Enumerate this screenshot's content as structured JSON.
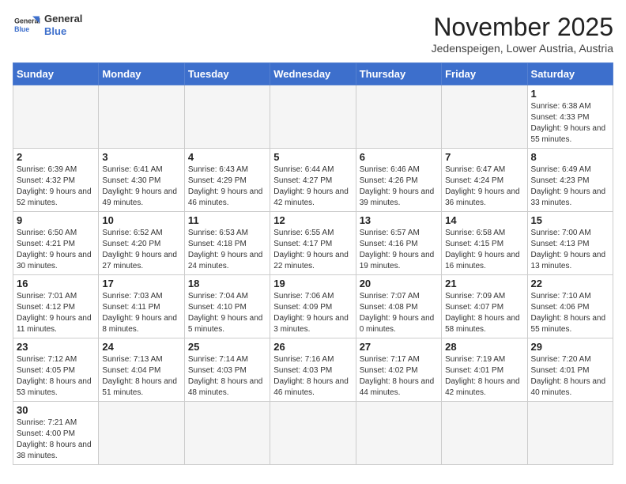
{
  "logo": {
    "line1": "General",
    "line2": "Blue"
  },
  "title": "November 2025",
  "subtitle": "Jedenspeigen, Lower Austria, Austria",
  "weekdays": [
    "Sunday",
    "Monday",
    "Tuesday",
    "Wednesday",
    "Thursday",
    "Friday",
    "Saturday"
  ],
  "weeks": [
    [
      {
        "day": "",
        "info": ""
      },
      {
        "day": "",
        "info": ""
      },
      {
        "day": "",
        "info": ""
      },
      {
        "day": "",
        "info": ""
      },
      {
        "day": "",
        "info": ""
      },
      {
        "day": "",
        "info": ""
      },
      {
        "day": "1",
        "info": "Sunrise: 6:38 AM\nSunset: 4:33 PM\nDaylight: 9 hours and 55 minutes."
      }
    ],
    [
      {
        "day": "2",
        "info": "Sunrise: 6:39 AM\nSunset: 4:32 PM\nDaylight: 9 hours and 52 minutes."
      },
      {
        "day": "3",
        "info": "Sunrise: 6:41 AM\nSunset: 4:30 PM\nDaylight: 9 hours and 49 minutes."
      },
      {
        "day": "4",
        "info": "Sunrise: 6:43 AM\nSunset: 4:29 PM\nDaylight: 9 hours and 46 minutes."
      },
      {
        "day": "5",
        "info": "Sunrise: 6:44 AM\nSunset: 4:27 PM\nDaylight: 9 hours and 42 minutes."
      },
      {
        "day": "6",
        "info": "Sunrise: 6:46 AM\nSunset: 4:26 PM\nDaylight: 9 hours and 39 minutes."
      },
      {
        "day": "7",
        "info": "Sunrise: 6:47 AM\nSunset: 4:24 PM\nDaylight: 9 hours and 36 minutes."
      },
      {
        "day": "8",
        "info": "Sunrise: 6:49 AM\nSunset: 4:23 PM\nDaylight: 9 hours and 33 minutes."
      }
    ],
    [
      {
        "day": "9",
        "info": "Sunrise: 6:50 AM\nSunset: 4:21 PM\nDaylight: 9 hours and 30 minutes."
      },
      {
        "day": "10",
        "info": "Sunrise: 6:52 AM\nSunset: 4:20 PM\nDaylight: 9 hours and 27 minutes."
      },
      {
        "day": "11",
        "info": "Sunrise: 6:53 AM\nSunset: 4:18 PM\nDaylight: 9 hours and 24 minutes."
      },
      {
        "day": "12",
        "info": "Sunrise: 6:55 AM\nSunset: 4:17 PM\nDaylight: 9 hours and 22 minutes."
      },
      {
        "day": "13",
        "info": "Sunrise: 6:57 AM\nSunset: 4:16 PM\nDaylight: 9 hours and 19 minutes."
      },
      {
        "day": "14",
        "info": "Sunrise: 6:58 AM\nSunset: 4:15 PM\nDaylight: 9 hours and 16 minutes."
      },
      {
        "day": "15",
        "info": "Sunrise: 7:00 AM\nSunset: 4:13 PM\nDaylight: 9 hours and 13 minutes."
      }
    ],
    [
      {
        "day": "16",
        "info": "Sunrise: 7:01 AM\nSunset: 4:12 PM\nDaylight: 9 hours and 11 minutes."
      },
      {
        "day": "17",
        "info": "Sunrise: 7:03 AM\nSunset: 4:11 PM\nDaylight: 9 hours and 8 minutes."
      },
      {
        "day": "18",
        "info": "Sunrise: 7:04 AM\nSunset: 4:10 PM\nDaylight: 9 hours and 5 minutes."
      },
      {
        "day": "19",
        "info": "Sunrise: 7:06 AM\nSunset: 4:09 PM\nDaylight: 9 hours and 3 minutes."
      },
      {
        "day": "20",
        "info": "Sunrise: 7:07 AM\nSunset: 4:08 PM\nDaylight: 9 hours and 0 minutes."
      },
      {
        "day": "21",
        "info": "Sunrise: 7:09 AM\nSunset: 4:07 PM\nDaylight: 8 hours and 58 minutes."
      },
      {
        "day": "22",
        "info": "Sunrise: 7:10 AM\nSunset: 4:06 PM\nDaylight: 8 hours and 55 minutes."
      }
    ],
    [
      {
        "day": "23",
        "info": "Sunrise: 7:12 AM\nSunset: 4:05 PM\nDaylight: 8 hours and 53 minutes."
      },
      {
        "day": "24",
        "info": "Sunrise: 7:13 AM\nSunset: 4:04 PM\nDaylight: 8 hours and 51 minutes."
      },
      {
        "day": "25",
        "info": "Sunrise: 7:14 AM\nSunset: 4:03 PM\nDaylight: 8 hours and 48 minutes."
      },
      {
        "day": "26",
        "info": "Sunrise: 7:16 AM\nSunset: 4:03 PM\nDaylight: 8 hours and 46 minutes."
      },
      {
        "day": "27",
        "info": "Sunrise: 7:17 AM\nSunset: 4:02 PM\nDaylight: 8 hours and 44 minutes."
      },
      {
        "day": "28",
        "info": "Sunrise: 7:19 AM\nSunset: 4:01 PM\nDaylight: 8 hours and 42 minutes."
      },
      {
        "day": "29",
        "info": "Sunrise: 7:20 AM\nSunset: 4:01 PM\nDaylight: 8 hours and 40 minutes."
      }
    ],
    [
      {
        "day": "30",
        "info": "Sunrise: 7:21 AM\nSunset: 4:00 PM\nDaylight: 8 hours and 38 minutes."
      },
      {
        "day": "",
        "info": ""
      },
      {
        "day": "",
        "info": ""
      },
      {
        "day": "",
        "info": ""
      },
      {
        "day": "",
        "info": ""
      },
      {
        "day": "",
        "info": ""
      },
      {
        "day": "",
        "info": ""
      }
    ]
  ]
}
